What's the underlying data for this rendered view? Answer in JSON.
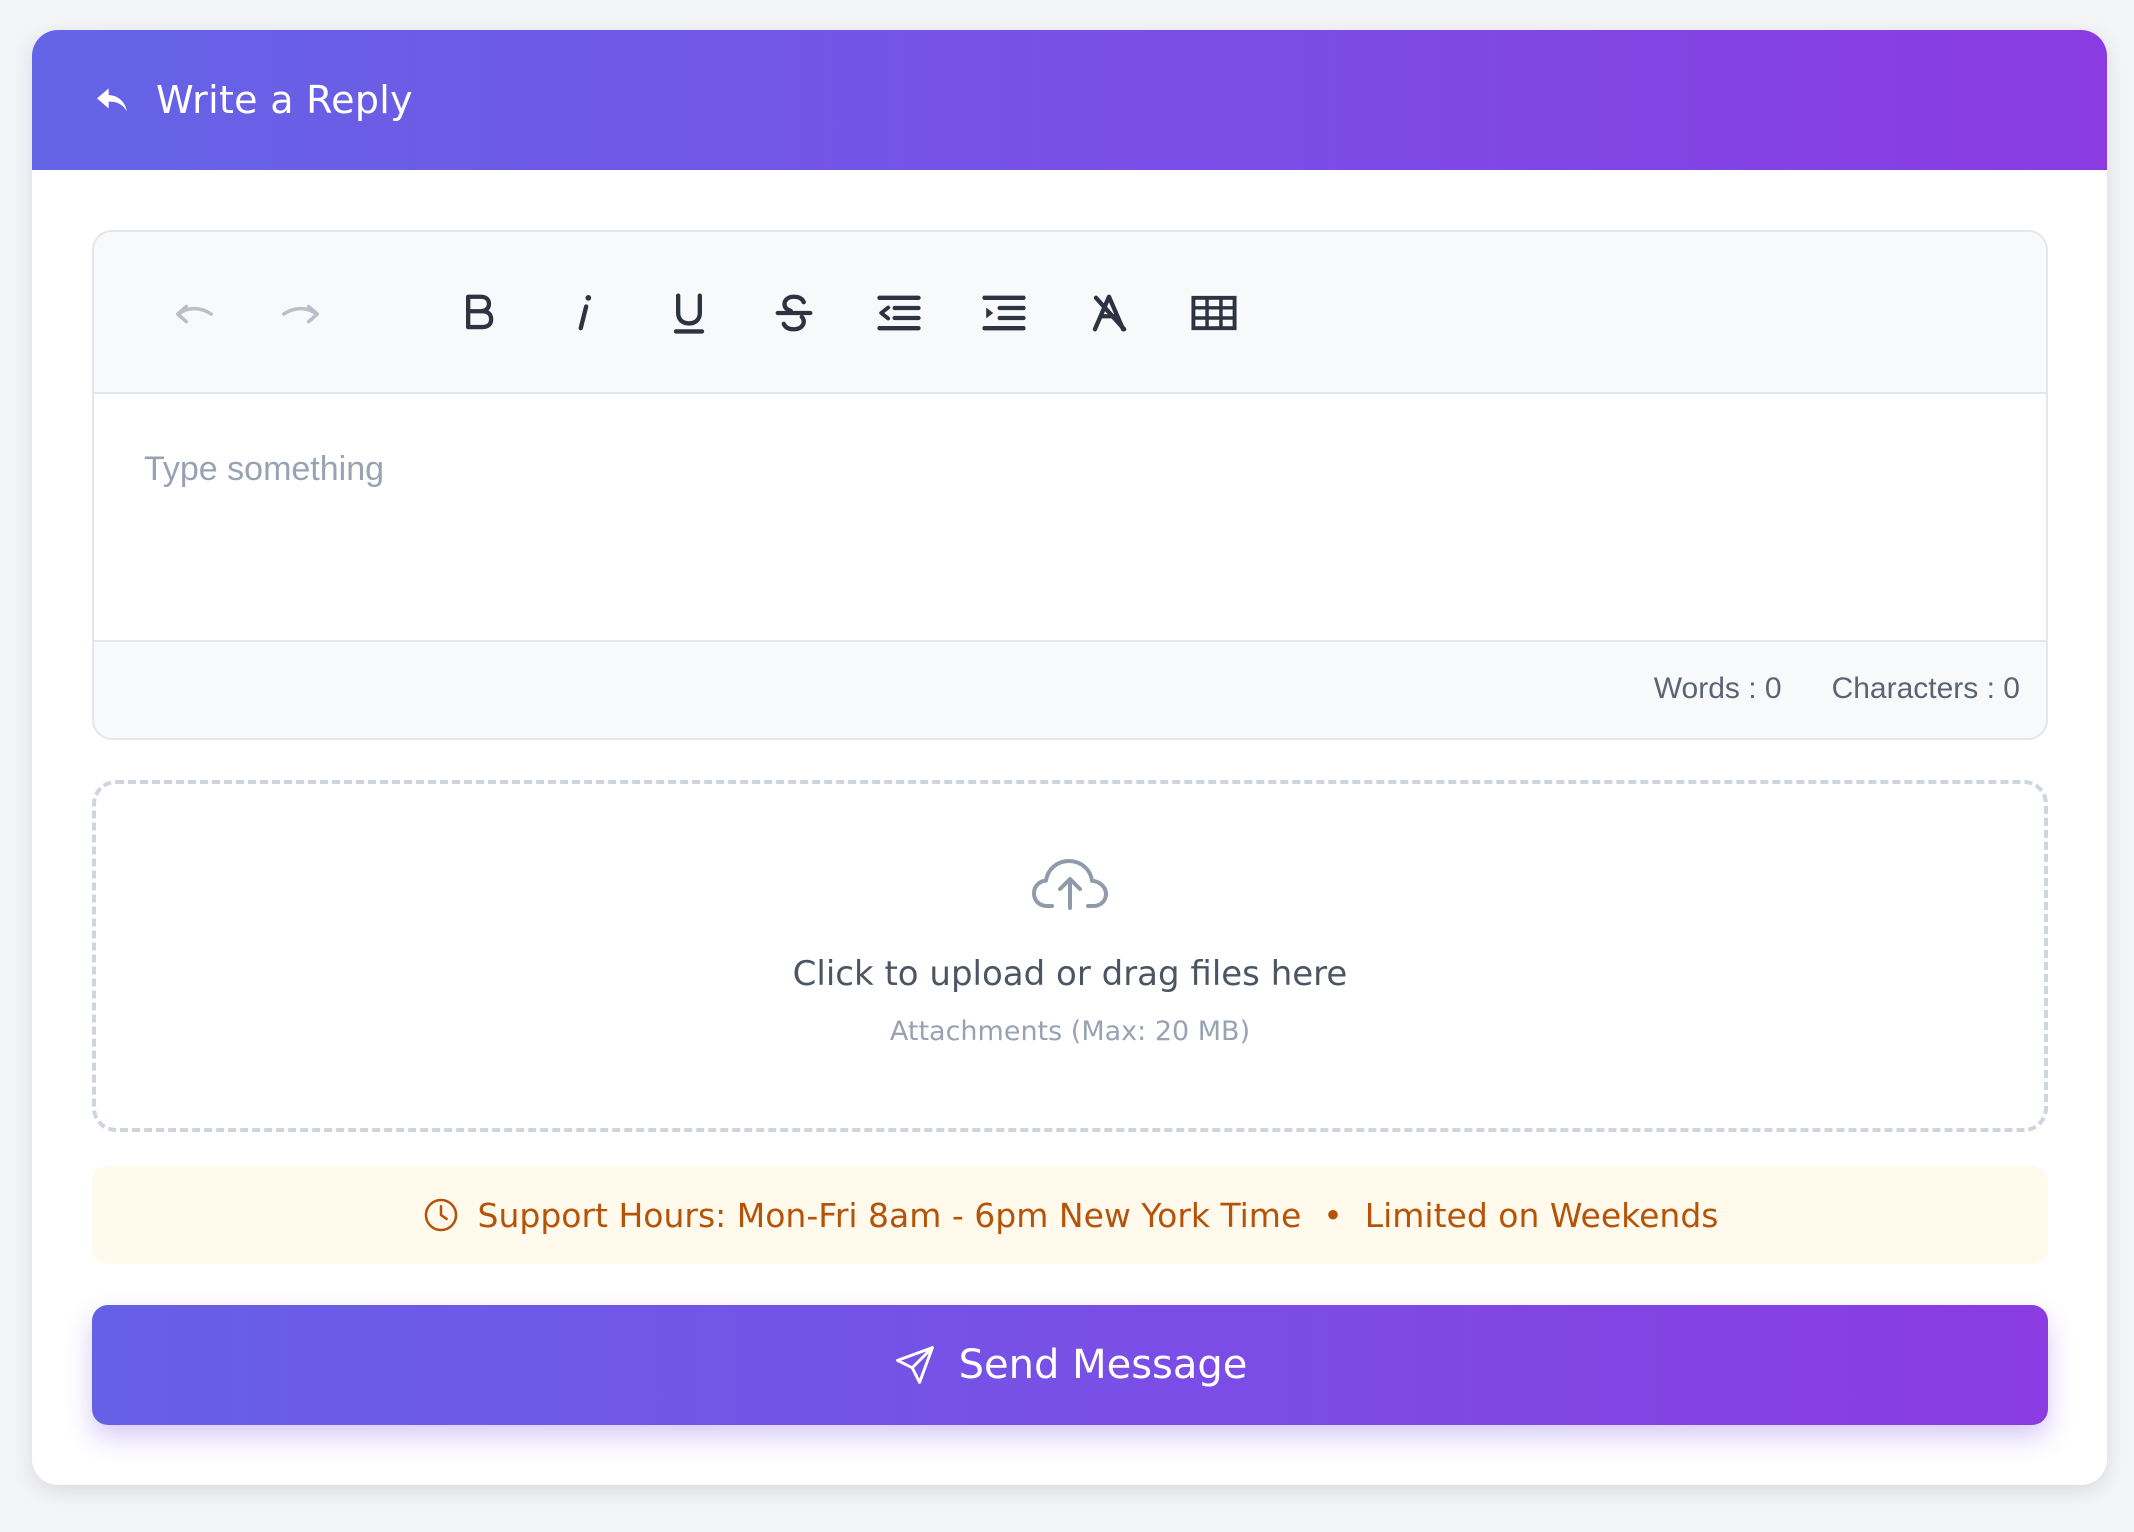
{
  "header": {
    "title": "Write a Reply",
    "icon": "reply-icon"
  },
  "editor": {
    "toolbar": [
      {
        "name": "undo",
        "icon": "undo-icon",
        "enabled": false
      },
      {
        "name": "redo",
        "icon": "redo-icon",
        "enabled": false
      },
      {
        "name": "bold",
        "icon": "bold-icon",
        "enabled": true
      },
      {
        "name": "italic",
        "icon": "italic-icon",
        "enabled": true
      },
      {
        "name": "underline",
        "icon": "underline-icon",
        "enabled": true
      },
      {
        "name": "strikethrough",
        "icon": "strikethrough-icon",
        "enabled": true
      },
      {
        "name": "outdent",
        "icon": "outdent-icon",
        "enabled": true
      },
      {
        "name": "indent",
        "icon": "indent-icon",
        "enabled": true
      },
      {
        "name": "clear-formatting",
        "icon": "clear-formatting-icon",
        "enabled": true
      },
      {
        "name": "table",
        "icon": "table-icon",
        "enabled": true
      }
    ],
    "placeholder": "Type something",
    "value": "",
    "words_label": "Words : 0",
    "characters_label": "Characters : 0"
  },
  "upload": {
    "icon": "cloud-upload-icon",
    "primary_text": "Click to upload or drag files here",
    "secondary_text": "Attachments (Max: 20 MB)"
  },
  "notice": {
    "icon": "clock-icon",
    "hours_text": "Support Hours: Mon-Fri 8am - 6pm New York Time",
    "separator": "•",
    "weekend_text": "Limited on Weekends"
  },
  "send_button": {
    "label": "Send Message",
    "icon": "send-icon"
  },
  "colors": {
    "accent_start": "#6464e6",
    "accent_end": "#8a3be2",
    "notice_text": "#b45309",
    "notice_bg": "#fffaeb"
  }
}
